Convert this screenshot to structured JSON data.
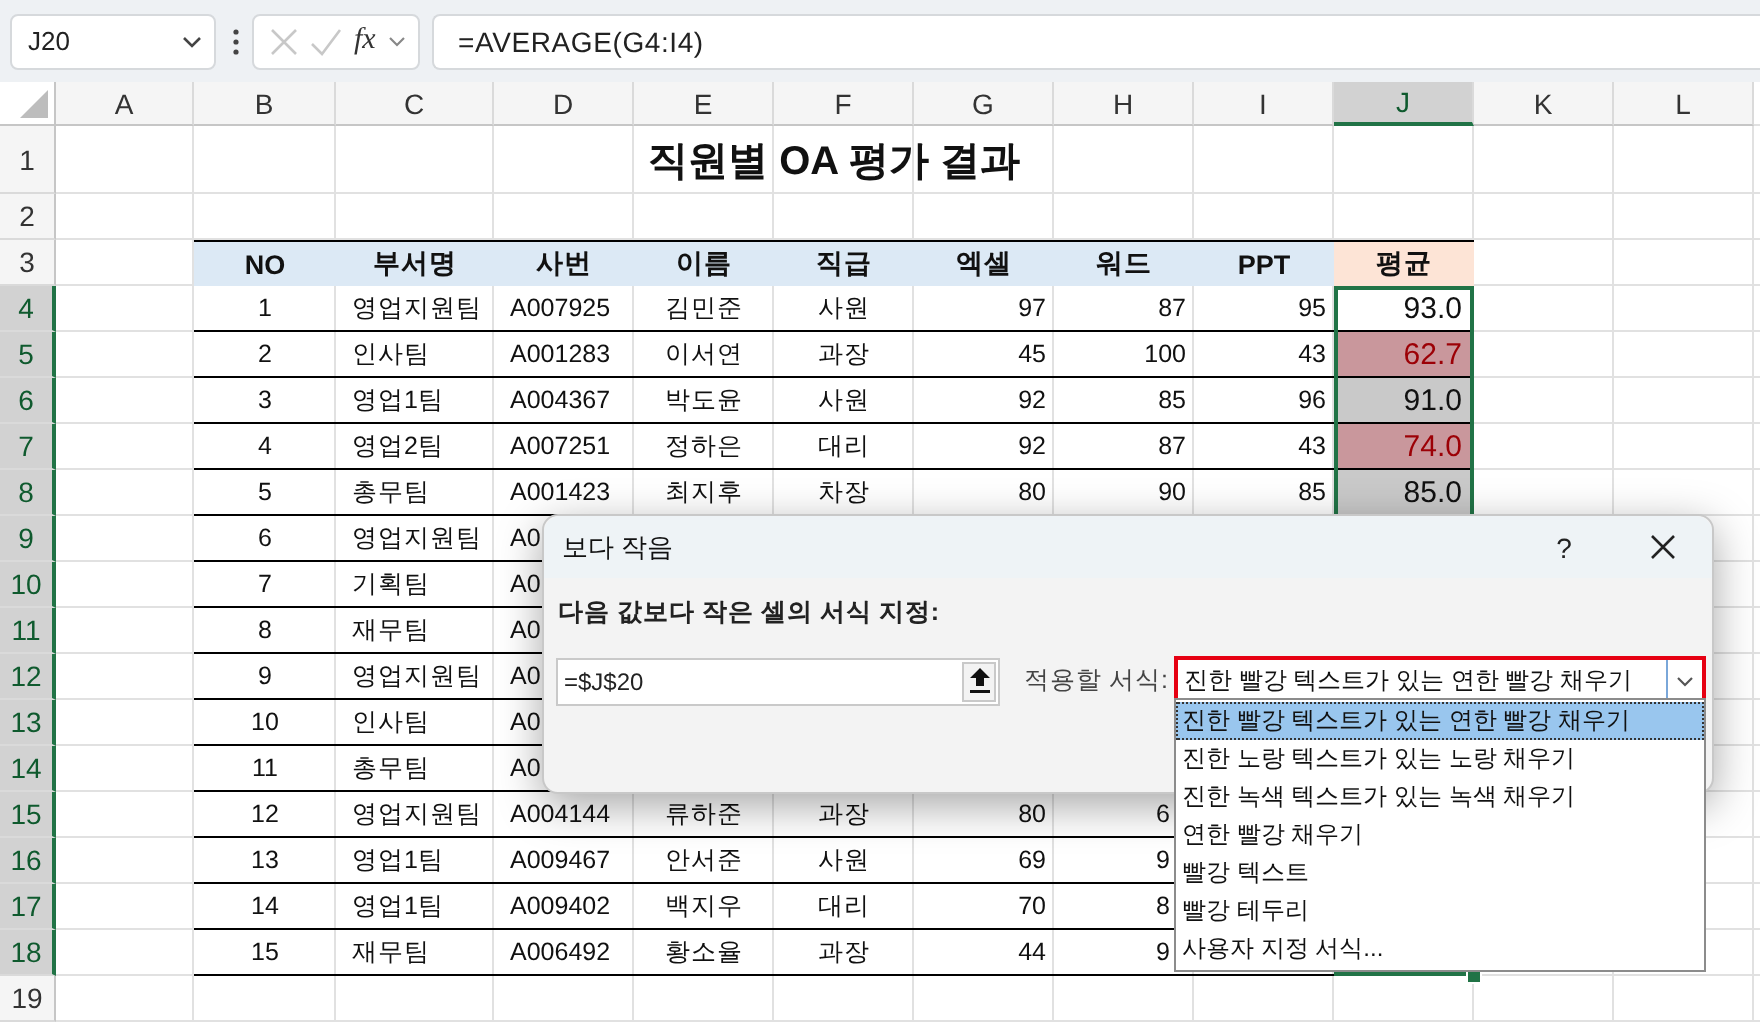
{
  "formula_bar": {
    "name_box": "J20",
    "fx": "fx",
    "formula": "=AVERAGE(G4:I4)"
  },
  "sheet": {
    "columns": [
      {
        "label": "A",
        "selected": false
      },
      {
        "label": "B",
        "selected": false
      },
      {
        "label": "C",
        "selected": false
      },
      {
        "label": "D",
        "selected": false
      },
      {
        "label": "E",
        "selected": false
      },
      {
        "label": "F",
        "selected": false
      },
      {
        "label": "G",
        "selected": false
      },
      {
        "label": "H",
        "selected": false
      },
      {
        "label": "I",
        "selected": false
      },
      {
        "label": "J",
        "selected": true
      },
      {
        "label": "K",
        "selected": false
      },
      {
        "label": "L",
        "selected": false
      }
    ],
    "row_headers": [
      {
        "label": "1",
        "selected": false
      },
      {
        "label": "2",
        "selected": false
      },
      {
        "label": "3",
        "selected": false
      },
      {
        "label": "4",
        "selected": true
      },
      {
        "label": "5",
        "selected": true
      },
      {
        "label": "6",
        "selected": true
      },
      {
        "label": "7",
        "selected": true
      },
      {
        "label": "8",
        "selected": true
      },
      {
        "label": "9",
        "selected": true
      },
      {
        "label": "10",
        "selected": true
      },
      {
        "label": "11",
        "selected": true
      },
      {
        "label": "12",
        "selected": true
      },
      {
        "label": "13",
        "selected": true
      },
      {
        "label": "14",
        "selected": true
      },
      {
        "label": "15",
        "selected": true
      },
      {
        "label": "16",
        "selected": true
      },
      {
        "label": "17",
        "selected": true
      },
      {
        "label": "18",
        "selected": true
      },
      {
        "label": "19",
        "selected": false
      }
    ],
    "title": "직원별 OA 평가 결과",
    "header": [
      "NO",
      "부서명",
      "사번",
      "이름",
      "직급",
      "엑셀",
      "워드",
      "PPT",
      "평균"
    ],
    "rows": [
      {
        "cells": [
          "",
          "1",
          "영업지원팀",
          "A007925",
          "김민준",
          "사원",
          "97",
          "87",
          "95"
        ],
        "average": {
          "value": "93.0",
          "red_fill": false,
          "active": true
        }
      },
      {
        "cells": [
          "",
          "2",
          "인사팀",
          "A001283",
          "이서연",
          "과장",
          "45",
          "100",
          "43"
        ],
        "average": {
          "value": "62.7",
          "red_fill": true,
          "active": false
        }
      },
      {
        "cells": [
          "",
          "3",
          "영업1팀",
          "A004367",
          "박도윤",
          "사원",
          "92",
          "85",
          "96"
        ],
        "average": {
          "value": "91.0",
          "red_fill": false,
          "active": false
        }
      },
      {
        "cells": [
          "",
          "4",
          "영업2팀",
          "A007251",
          "정하은",
          "대리",
          "92",
          "87",
          "43"
        ],
        "average": {
          "value": "74.0",
          "red_fill": true,
          "active": false
        }
      },
      {
        "cells": [
          "",
          "5",
          "총무팀",
          "A001423",
          "최지후",
          "차장",
          "80",
          "90",
          "85"
        ],
        "average": {
          "value": "85.0",
          "red_fill": false,
          "active": false
        }
      },
      {
        "cells": [
          "",
          "6",
          "영업지원팀",
          "A0"
        ]
      },
      {
        "cells": [
          "",
          "7",
          "기획팀",
          "A0"
        ]
      },
      {
        "cells": [
          "",
          "8",
          "재무팀",
          "A0"
        ]
      },
      {
        "cells": [
          "",
          "9",
          "영업지원팀",
          "A0"
        ]
      },
      {
        "cells": [
          "",
          "10",
          "인사팀",
          "A0"
        ]
      },
      {
        "cells": [
          "",
          "11",
          "총무팀",
          "A0"
        ]
      },
      {
        "cells": [
          "",
          "12",
          "영업지원팀",
          "A004144",
          "류하준",
          "과장",
          "80"
        ],
        "partial": "6"
      },
      {
        "cells": [
          "",
          "13",
          "영업1팀",
          "A009467",
          "안서준",
          "사원",
          "69"
        ],
        "partial": "9"
      },
      {
        "cells": [
          "",
          "14",
          "영업1팀",
          "A009402",
          "백지우",
          "대리",
          "70"
        ],
        "partial": "8"
      },
      {
        "cells": [
          "",
          "15",
          "재무팀",
          "A006492",
          "황소율",
          "과장",
          "44"
        ],
        "partial": "9"
      }
    ]
  },
  "dialog": {
    "title": "보다 작음",
    "help": "?",
    "prompt": "다음 값보다 작은 셀의 서식 지정:",
    "reference": "=$J$20",
    "format_label": "적용할 서식:",
    "format_value": "진한 빨강 텍스트가 있는 연한 빨강 채우기",
    "options": [
      {
        "label": "진한 빨강 텍스트가 있는 연한 빨강 채우기",
        "selected": true
      },
      {
        "label": "진한 노랑 텍스트가 있는 노랑 채우기",
        "selected": false
      },
      {
        "label": "진한 녹색 텍스트가 있는 녹색 채우기",
        "selected": false
      },
      {
        "label": "연한 빨강 채우기",
        "selected": false
      },
      {
        "label": "빨강 텍스트",
        "selected": false
      },
      {
        "label": "빨강 테두리",
        "selected": false
      },
      {
        "label": "사용자 지정 서식...",
        "selected": false
      }
    ]
  }
}
